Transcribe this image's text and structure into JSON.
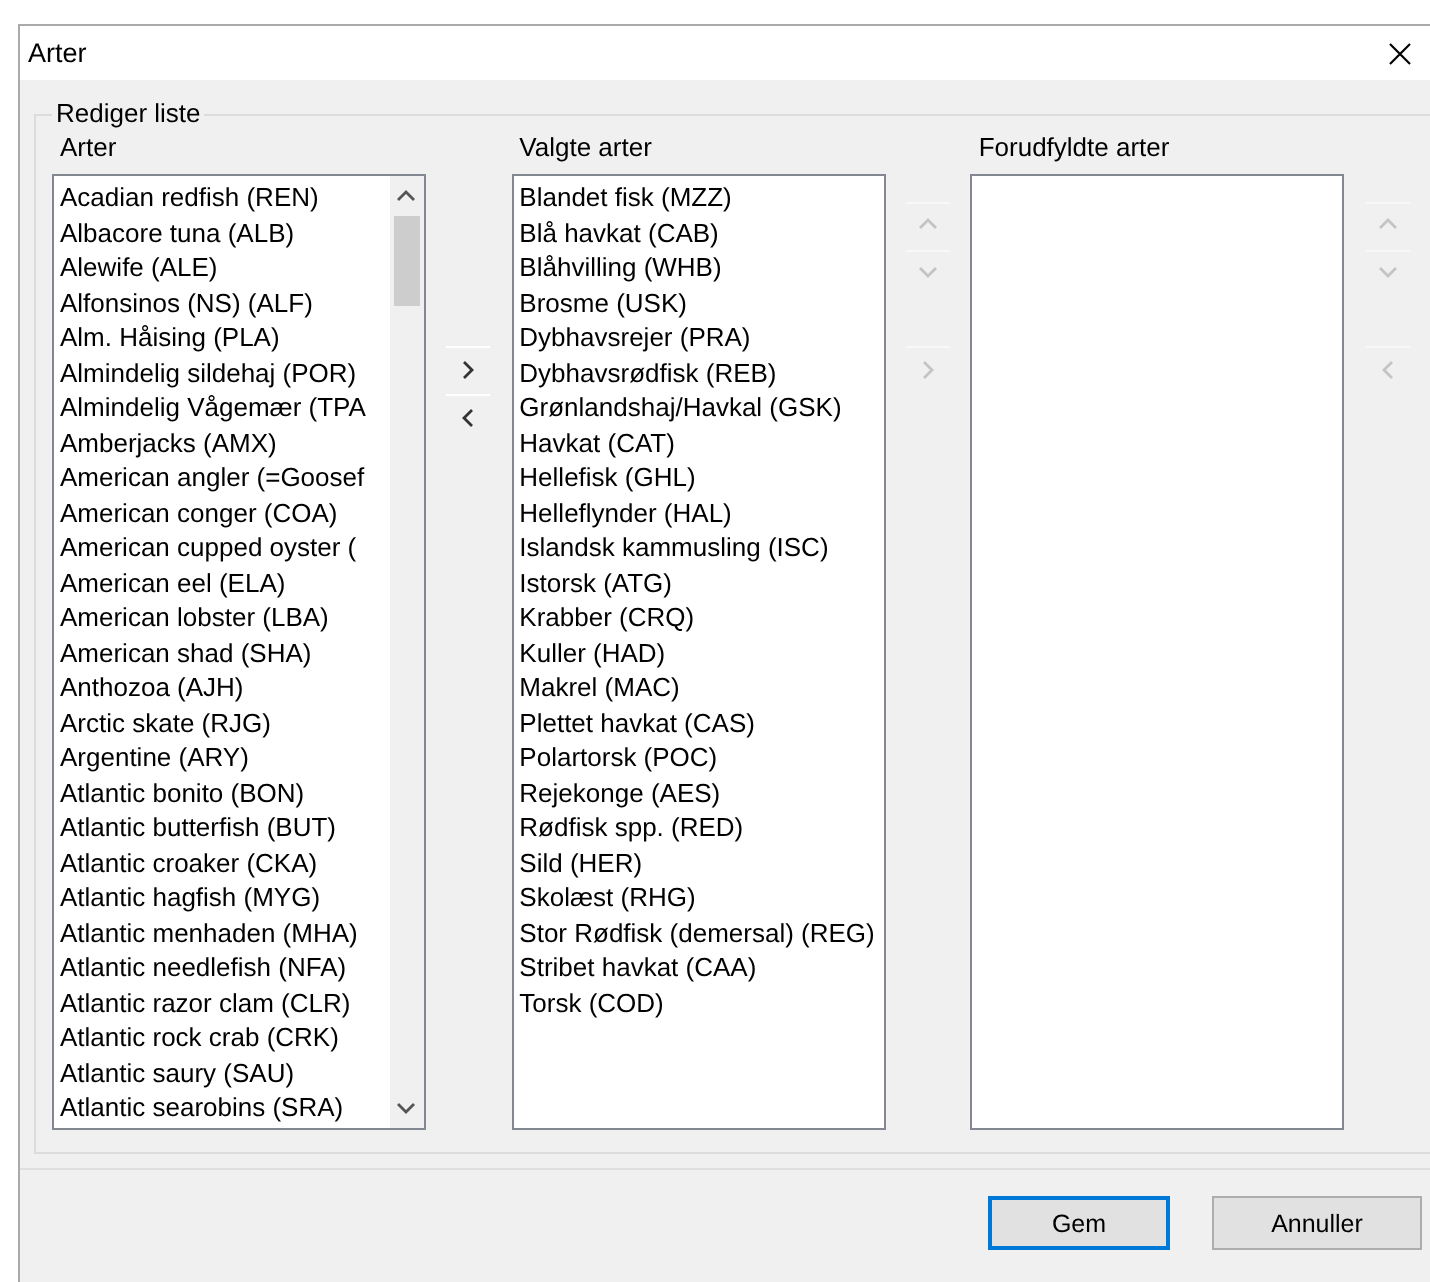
{
  "window": {
    "title": "Arter"
  },
  "group": {
    "legend": "Rediger liste"
  },
  "panels": [
    {
      "label": "Arter",
      "scrollbar": true,
      "items": [
        "Acadian redfish (REN)",
        "Albacore tuna (ALB)",
        "Alewife (ALE)",
        "Alfonsinos (NS) (ALF)",
        "Alm. Håising (PLA)",
        "Almindelig sildehaj (POR)",
        "Almindelig Vågemær (TPA",
        "Amberjacks (AMX)",
        "American angler (=Goosef",
        "American conger (COA)",
        "American cupped oyster (",
        "American eel (ELA)",
        "American lobster (LBA)",
        "American shad (SHA)",
        "Anthozoa (AJH)",
        "Arctic skate (RJG)",
        "Argentine (ARY)",
        "Atlantic bonito (BON)",
        "Atlantic butterfish (BUT)",
        "Atlantic croaker (CKA)",
        "Atlantic hagfish (MYG)",
        "Atlantic menhaden (MHA)",
        "Atlantic needlefish (NFA)",
        "Atlantic razor clam (CLR)",
        "Atlantic rock crab (CRK)",
        "Atlantic saury (SAU)",
        "Atlantic searobins (SRA)"
      ],
      "buttons": [
        {
          "kind": "right",
          "disabled": false
        },
        {
          "kind": "left",
          "disabled": false
        }
      ]
    },
    {
      "label": "Valgte arter",
      "scrollbar": false,
      "items": [
        "Blandet fisk (MZZ)",
        "Blå havkat (CAB)",
        "Blåhvilling (WHB)",
        "Brosme (USK)",
        "Dybhavsrejer (PRA)",
        "Dybhavsrødfisk (REB)",
        "Grønlandshaj/Havkal (GSK)",
        "Havkat (CAT)",
        "Hellefisk (GHL)",
        "Helleflynder (HAL)",
        "Islandsk kammusling (ISC)",
        "Istorsk (ATG)",
        "Krabber (CRQ)",
        "Kuller (HAD)",
        "Makrel (MAC)",
        "Plettet havkat (CAS)",
        "Polartorsk (POC)",
        "Rejekonge (AES)",
        "Rødfisk spp. (RED)",
        "Sild (HER)",
        "Skolæst (RHG)",
        "Stor Rødfisk (demersal) (REG)",
        "Stribet havkat (CAA)",
        "Torsk (COD)"
      ],
      "buttons": [
        {
          "kind": "up",
          "disabled": true
        },
        {
          "kind": "down",
          "disabled": true
        },
        {
          "kind": "right",
          "disabled": true
        }
      ]
    },
    {
      "label": "Forudfyldte arter",
      "scrollbar": false,
      "buttons": [
        {
          "kind": "up",
          "disabled": true
        },
        {
          "kind": "down",
          "disabled": true
        },
        {
          "kind": "left",
          "disabled": true
        }
      ]
    }
  ],
  "footer_buttons": [
    {
      "label": "Gem",
      "focused": true
    },
    {
      "label": "Annuller",
      "focused": false
    }
  ]
}
